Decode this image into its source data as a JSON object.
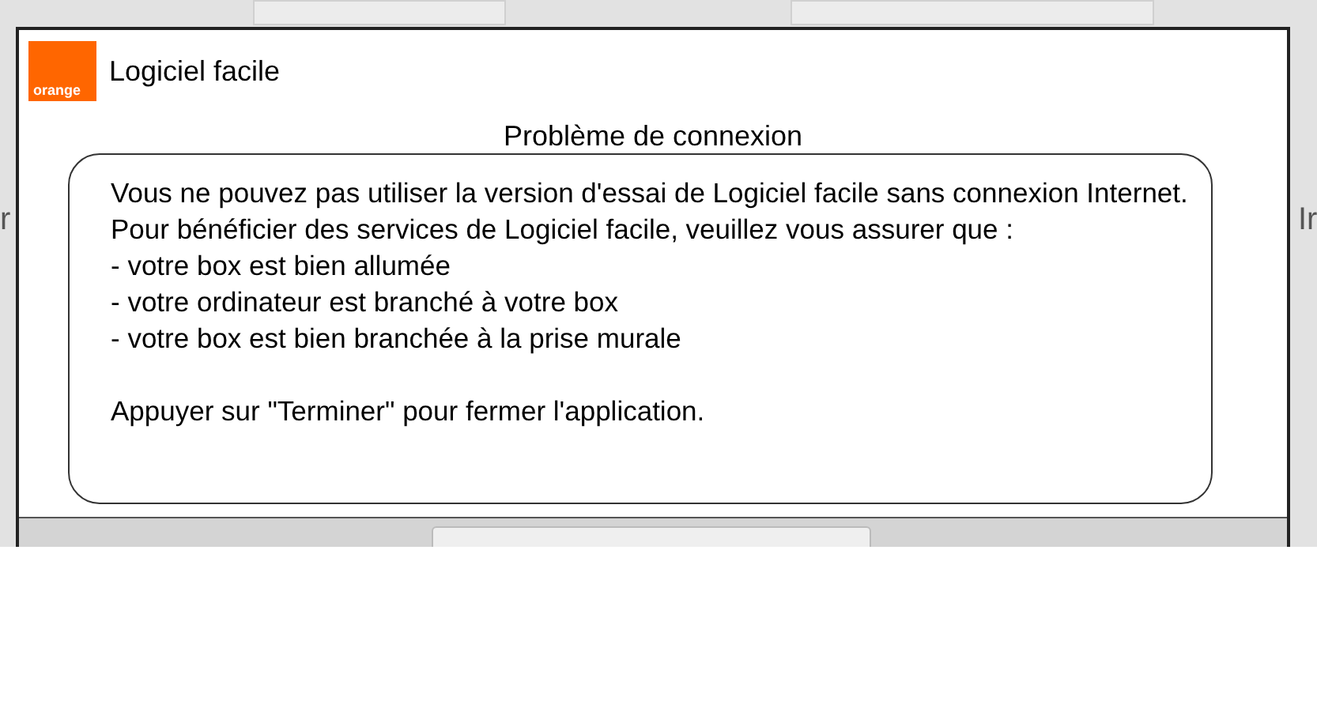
{
  "backdrop": {
    "left_text": "r",
    "right_text": "Ir"
  },
  "dialog": {
    "logo": "orange",
    "title": "Logiciel facile",
    "heading": "Problème de connexion",
    "paragraphs": [
      [
        "Vous ne pouvez pas utiliser la version d'essai de Logiciel facile sans connexion Internet.",
        "Pour bénéficier des services de Logiciel facile, veuillez vous assurer que :",
        "- votre box est bien allumée",
        "- votre ordinateur est branché à votre box",
        "- votre box est bien branchée à la prise murale"
      ],
      [
        "Appuyer sur \"Terminer\" pour fermer l'application."
      ]
    ]
  }
}
